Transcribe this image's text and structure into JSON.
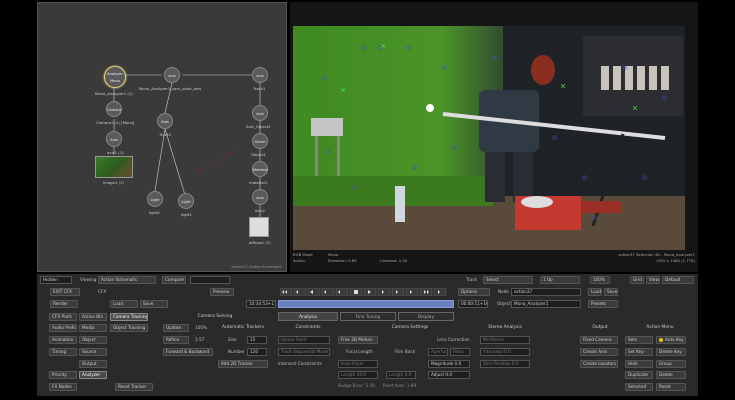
{
  "schematic": {
    "title": "action37 Action Schematic",
    "nodes": {
      "analyzer": "Analyzer Mono",
      "analyzer_label": "Mono_Analyzer1 (1)",
      "axis_top": "Axis",
      "axis_top_label": "Mono_Analyzer1_cam_point_axis",
      "camera": "Camera",
      "camera_label": "Camera1 (1) [Mono]",
      "axis_left": "Axis",
      "axis_left_label": "axis1 (1)",
      "image_label": "image1 (1)",
      "axis_mid": "Axis",
      "axis_mid_label": "Track1",
      "light1": "Light",
      "light1_label": "light2",
      "light2": "Light",
      "light2_label": "light1",
      "axis_right_top": "Axis",
      "axis_right_top_label": "Track1",
      "axis_right2": "Axis",
      "axis_right2_label": "Axis_Object2",
      "geom": "Geom",
      "geom_label": "Object1",
      "material": "Material",
      "material_label": "material1",
      "axis_right3": "Axis",
      "axis_right3_label": "axis2",
      "diffuse_label": "diffuse1 (2)"
    }
  },
  "viewer": {
    "top_left": "RGB Mode",
    "top_left2": "Action",
    "top_mid1": "Mono",
    "top_mid2": "Elevation: 0.89",
    "top_mid3": "Contrast: 1.00",
    "top_right1": "action37 Selection 3D - Mono_Analyzer1",
    "top_right2": "1920 x 1080 (1.778)"
  },
  "row1": {
    "hidden": "Hidden",
    "viewing_label": "Viewing",
    "viewing_value": "Action Schematic",
    "compare": "Compare",
    "track_label": "Track",
    "track_value": "Select",
    "frame_value": "1 Up",
    "zoom": "100%",
    "grid": "Grid",
    "view": "View",
    "default": "Default"
  },
  "row2": {
    "exit": "EXIT CFX",
    "cfx": "CFX",
    "preview": "Preview",
    "options": "Options",
    "node_label": "Node",
    "node_value": "action37",
    "load": "Load",
    "save": "Save"
  },
  "row3": {
    "render": "Render",
    "load": "Load",
    "save": "Save",
    "timecode_in": "10:34:53+11",
    "timecode_out": "00:00:11+16",
    "object_label": "Object",
    "object_value": "Mono_Analyzer1",
    "presets": "Presets"
  },
  "tabs": {
    "analysis": "Analysis",
    "fine_tuning": "Fine Tuning",
    "display": "Display"
  },
  "left_col": {
    "a1": "CFX Prefs",
    "b1": "Active Btn",
    "a2": "Audio Prefs",
    "b2": "Media",
    "a3": "Animation",
    "b3": "Object",
    "a4": "Timing",
    "b4": "Source",
    "b5": "Output",
    "a6": "Priority",
    "b6": "Analyzer",
    "a7": "FX Nodes"
  },
  "sections": {
    "camera_solving": "Camera Solving",
    "camera_tracking": "Camera Tracking",
    "object_tracking": "Object Tracking",
    "update": "Update",
    "update_pct": "100%",
    "refine": "Refine",
    "refine_val": "3.57",
    "forward_backward": "Forward & Backward",
    "reset_tracker": "Reset Tracker",
    "auto_trackers": "Automatic Trackers",
    "size_label": "Size",
    "size_val": "15",
    "number_label": "Number",
    "number_val": "120",
    "add_2d": "Add 2D Tracker",
    "constraints": "Constraints",
    "ignore_fixed": "Ignore Fixed",
    "track_seq": "Track Sequential Mode",
    "intersect": "Intersect Constraints",
    "camera_settings": "Camera Settings",
    "free_3d": "Free 3D Motion",
    "focal_length": "Focal Length",
    "auto_focal": "Auto Focal",
    "length_val": "Length 35.0",
    "filmback": "Film Back",
    "filmback_val": "Length 0.0",
    "aperture": "Aperture",
    "ratio": "Ratio",
    "lens_correction": "Lens Correction",
    "magnitude": "Magnitude 0.0",
    "adjust": "Adjust 0.0",
    "pixel_aspect": "Pixel Aspect 1.00",
    "budge_error": "Budge Error: 2.56",
    "point_avg": "Point Aver: 1.89",
    "stereo_analysis": "Stereo Analysis",
    "no_stereo": "No Stereo",
    "interaxial": "Interaxial 0.0",
    "zero_parallax": "Zero Parallax 0.0",
    "output": "Output",
    "fixed_camera": "Fixed Camera",
    "create_axis": "Create Axis",
    "create_locators": "Create Locators",
    "action_menu": "Action Menu",
    "sets": "Sets",
    "auto_key": "Auto Key",
    "set_key": "Set Key",
    "delete_key": "Delete Key",
    "hide": "Hide",
    "group": "Group",
    "duplicate": "Duplicate",
    "delete": "Delete",
    "selected": "Selected",
    "reset": "Reset"
  }
}
